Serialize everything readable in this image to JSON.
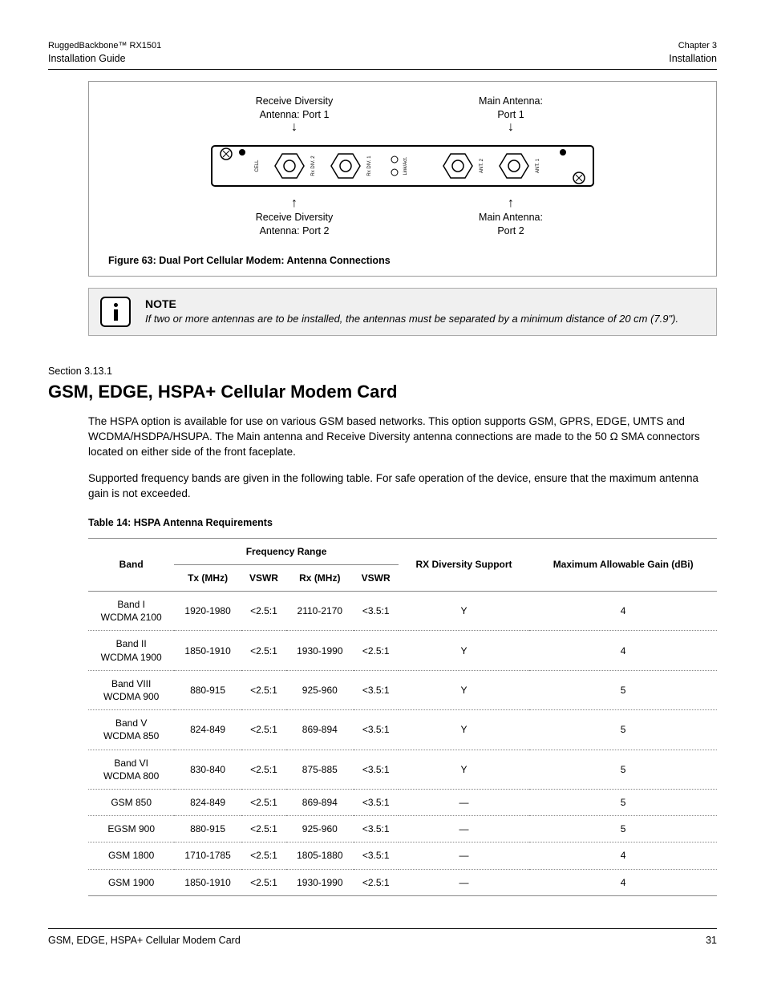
{
  "header": {
    "product_line1": "RuggedBackbone™ RX1501",
    "product_line2": "Installation Guide",
    "chapter_line1": "Chapter 3",
    "chapter_line2": "Installation"
  },
  "figure": {
    "top_left_label_l1": "Receive Diversity",
    "top_left_label_l2": "Antenna: Port 1",
    "top_right_label_l1": "Main Antenna:",
    "top_right_label_l2": "Port 1",
    "bottom_left_label_l1": "Receive Diversity",
    "bottom_left_label_l2": "Antenna: Port 2",
    "bottom_right_label_l1": "Main Antenna:",
    "bottom_right_label_l2": "Port 2",
    "port_labels": [
      "CELL",
      "Rx DIV. 2",
      "Rx DIV. 1",
      "Link/Act.",
      "ANT. 2",
      "ANT. 1"
    ],
    "caption": "Figure 63: Dual Port Cellular Modem: Antenna Connections"
  },
  "note": {
    "title": "NOTE",
    "text": "If two or more antennas are to be installed, the antennas must be separated by a minimum distance of 20 cm (7.9\")."
  },
  "section": {
    "num": "Section 3.13.1",
    "title": "GSM, EDGE, HSPA+ Cellular Modem Card",
    "para1": "The HSPA option is available for use on various GSM based networks. This option supports GSM, GPRS, EDGE, UMTS and WCDMA/HSDPA/HSUPA. The Main antenna and Receive Diversity antenna connections are made to the 50 Ω SMA connectors located on either side of the front faceplate.",
    "para2": "Supported frequency bands are given in the following table. For safe operation of the device, ensure that the maximum antenna gain is not exceeded."
  },
  "table": {
    "caption": "Table 14: HSPA Antenna Requirements",
    "headers": {
      "band": "Band",
      "freq_range": "Frequency Range",
      "tx": "Tx (MHz)",
      "vswr1": "VSWR",
      "rx": "Rx (MHz)",
      "vswr2": "VSWR",
      "rx_div": "RX Diversity Support",
      "gain": "Maximum Allowable Gain (dBi)"
    },
    "rows": [
      {
        "band": "Band I\nWCDMA 2100",
        "tx": "1920-1980",
        "vswr1": "<2.5:1",
        "rx": "2110-2170",
        "vswr2": "<3.5:1",
        "div": "Y",
        "gain": "4"
      },
      {
        "band": "Band II\nWCDMA 1900",
        "tx": "1850-1910",
        "vswr1": "<2.5:1",
        "rx": "1930-1990",
        "vswr2": "<2.5:1",
        "div": "Y",
        "gain": "4"
      },
      {
        "band": "Band VIII\nWCDMA 900",
        "tx": "880-915",
        "vswr1": "<2.5:1",
        "rx": "925-960",
        "vswr2": "<3.5:1",
        "div": "Y",
        "gain": "5"
      },
      {
        "band": "Band V\nWCDMA 850",
        "tx": "824-849",
        "vswr1": "<2.5:1",
        "rx": "869-894",
        "vswr2": "<3.5:1",
        "div": "Y",
        "gain": "5"
      },
      {
        "band": "Band VI\nWCDMA 800",
        "tx": "830-840",
        "vswr1": "<2.5:1",
        "rx": "875-885",
        "vswr2": "<3.5:1",
        "div": "Y",
        "gain": "5"
      },
      {
        "band": "GSM 850",
        "tx": "824-849",
        "vswr1": "<2.5:1",
        "rx": "869-894",
        "vswr2": "<3.5:1",
        "div": "—",
        "gain": "5"
      },
      {
        "band": "EGSM 900",
        "tx": "880-915",
        "vswr1": "<2.5:1",
        "rx": "925-960",
        "vswr2": "<3.5:1",
        "div": "—",
        "gain": "5"
      },
      {
        "band": "GSM 1800",
        "tx": "1710-1785",
        "vswr1": "<2.5:1",
        "rx": "1805-1880",
        "vswr2": "<3.5:1",
        "div": "—",
        "gain": "4"
      },
      {
        "band": "GSM 1900",
        "tx": "1850-1910",
        "vswr1": "<2.5:1",
        "rx": "1930-1990",
        "vswr2": "<2.5:1",
        "div": "—",
        "gain": "4"
      }
    ]
  },
  "footer": {
    "left": "GSM, EDGE, HSPA+ Cellular Modem Card",
    "right": "31"
  }
}
